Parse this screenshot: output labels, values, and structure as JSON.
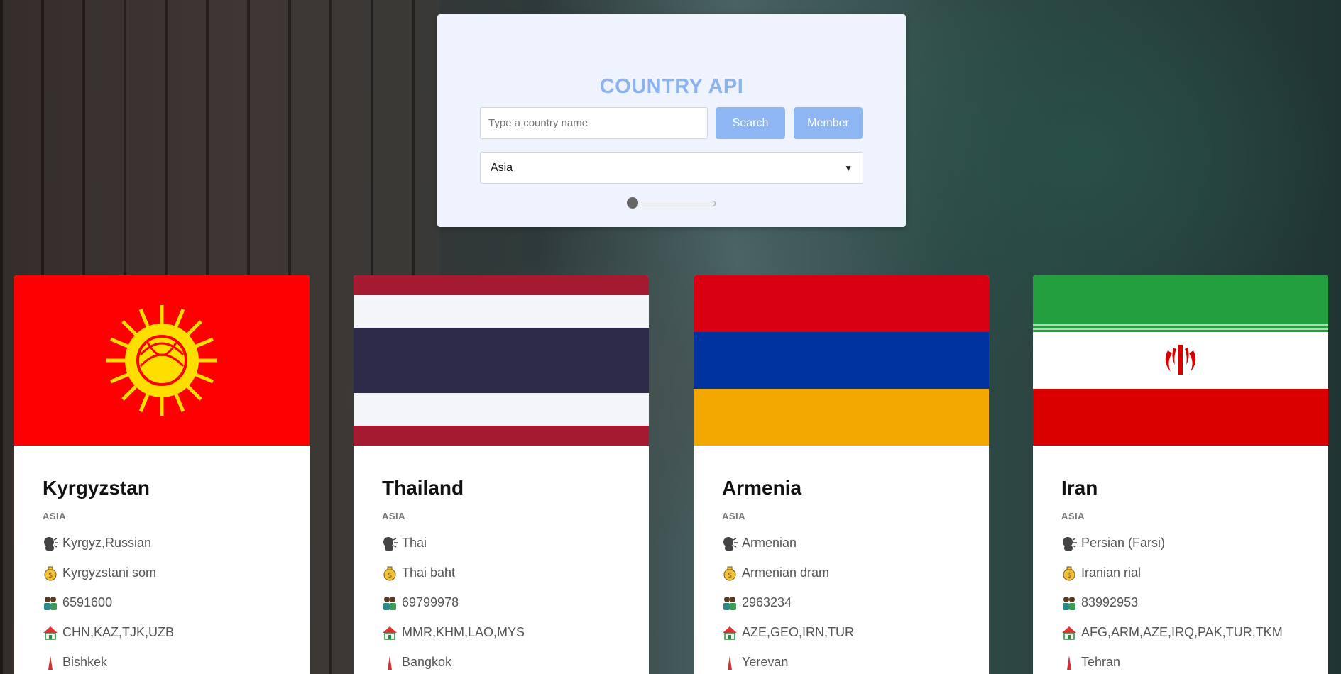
{
  "panel": {
    "title": "COUNTRY API",
    "search_placeholder": "Type a country name",
    "search_label": "Search",
    "member_label": "Member",
    "region_selected": "Asia",
    "slider_value": 0
  },
  "icons": {
    "language": "speaking-head-icon",
    "currency": "money-bag-icon",
    "population": "people-icon",
    "borders": "house-icon",
    "capital": "tower-icon"
  },
  "countries": [
    {
      "name": "Kyrgyzstan",
      "region": "ASIA",
      "languages": "Kyrgyz,Russian",
      "currency": "Kyrgyzstani som",
      "population": "6591600",
      "borders": "CHN,KAZ,TJK,UZB",
      "capital": "Bishkek"
    },
    {
      "name": "Thailand",
      "region": "ASIA",
      "languages": "Thai",
      "currency": "Thai baht",
      "population": "69799978",
      "borders": "MMR,KHM,LAO,MYS",
      "capital": "Bangkok"
    },
    {
      "name": "Armenia",
      "region": "ASIA",
      "languages": "Armenian",
      "currency": "Armenian dram",
      "population": "2963234",
      "borders": "AZE,GEO,IRN,TUR",
      "capital": "Yerevan"
    },
    {
      "name": "Iran",
      "region": "ASIA",
      "languages": "Persian (Farsi)",
      "currency": "Iranian rial",
      "population": "83992953",
      "borders": "AFG,ARM,AZE,IRQ,PAK,TUR,TKM",
      "capital": "Tehran"
    }
  ]
}
